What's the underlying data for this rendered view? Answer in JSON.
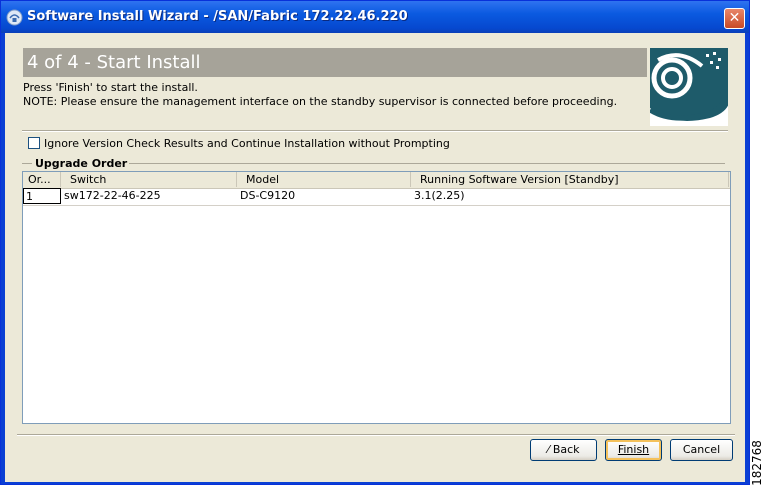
{
  "window": {
    "title": "Software Install Wizard - /SAN/Fabric 172.22.46.220",
    "close_label": "✕"
  },
  "header": {
    "step_title": "4 of 4 - Start Install",
    "instruction": "Press 'Finish' to start the install.",
    "note": "NOTE: Please ensure the management interface on the standby supervisor is connected before proceeding."
  },
  "options": {
    "ignore_version_check_label": "Ignore Version Check Results and Continue Installation without Prompting",
    "ignore_version_check_checked": false
  },
  "upgrade_order": {
    "group_title": "Upgrade Order",
    "columns": [
      "Or...",
      "Switch",
      "Model",
      "Running Software Version [Standby]"
    ],
    "rows": [
      {
        "order": "1",
        "switch": "sw172-22-46-225",
        "model": "DS-C9120",
        "version": "3.1(2.25)"
      }
    ]
  },
  "buttons": {
    "back": "Back",
    "finish": "Finish",
    "cancel": "Cancel"
  },
  "figure_number": "182768",
  "colors": {
    "title_bar": "#0a5ae0",
    "dialog_bg": "#ece9d8",
    "banner_bg": "#a6a399",
    "logo_bg": "#1e5b6a"
  }
}
